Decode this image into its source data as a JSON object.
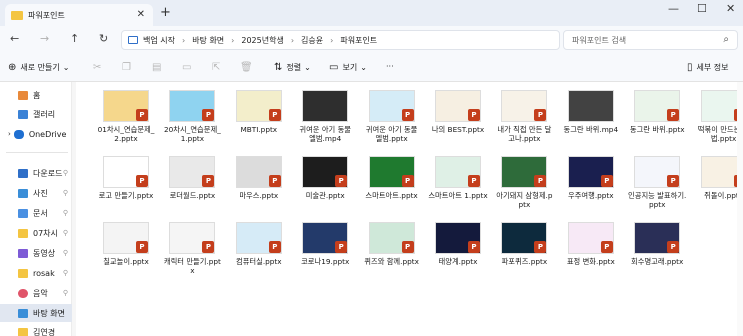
{
  "window": {
    "tab_title": "파워포인트",
    "new_tab": "+",
    "minimize": "—",
    "maximize": "☐",
    "close": "✕"
  },
  "nav": {
    "back": "←",
    "forward": "→",
    "up": "↑",
    "refresh": "↻",
    "breadcrumb": [
      "백업 시작",
      "바탕 화면",
      "2025년학생",
      "김승윤",
      "파워포인트"
    ],
    "search_placeholder": "파워포인트 검색"
  },
  "toolbar": {
    "new_label": "새로 만들기",
    "sort_label": "정렬",
    "view_label": "보기",
    "more_label": "···",
    "details_label": "세부 정보"
  },
  "sidebar": {
    "items": [
      {
        "label": "홈",
        "color": "#e8893a"
      },
      {
        "label": "갤러리",
        "color": "#3b82d6"
      },
      {
        "label": "OneDrive",
        "color": "#1f6fd1"
      },
      {
        "label": "다운로드",
        "color": "#2f6fc8"
      },
      {
        "label": "사진",
        "color": "#3a8ed8"
      },
      {
        "label": "문서",
        "color": "#4a90e2"
      },
      {
        "label": "07차시",
        "color": "#f4c542"
      },
      {
        "label": "동영상",
        "color": "#7d5bd6"
      },
      {
        "label": "rosak",
        "color": "#f4c542"
      },
      {
        "label": "음악",
        "color": "#e0556a"
      },
      {
        "label": "바탕 화면",
        "color": "#3a8ed8"
      },
      {
        "label": "김연경",
        "color": "#f4c542"
      }
    ]
  },
  "files": [
    {
      "name": "01차시_연습문제_2.pptx",
      "color": "#f5d78c",
      "ppt": true
    },
    {
      "name": "20차시_연습문제_1.pptx",
      "color": "#8fd3f0",
      "ppt": true
    },
    {
      "name": "MBTI.pptx",
      "color": "#f3eecb",
      "ppt": true
    },
    {
      "name": "귀여운 아기 동물 엘범.mp4",
      "color": "#2e2e2e",
      "ppt": false
    },
    {
      "name": "귀여운 아기 동물 엘범.pptx",
      "color": "#d5ecf7",
      "ppt": true
    },
    {
      "name": "나의 BEST.pptx",
      "color": "#f6efe2",
      "ppt": true
    },
    {
      "name": "내가 직접 만든 달고나.pptx",
      "color": "#f7f2e8",
      "ppt": true
    },
    {
      "name": "동그란 바위.mp4",
      "color": "#424242",
      "ppt": false
    },
    {
      "name": "동그란 바위.pptx",
      "color": "#eaf4ea",
      "ppt": true
    },
    {
      "name": "떡볶이 만드는 방법.pptx",
      "color": "#eaf6ef",
      "ppt": true
    },
    {
      "name": "로고 만들기.pptx",
      "color": "#ffffff",
      "ppt": true
    },
    {
      "name": "로더월드.pptx",
      "color": "#e9e9e9",
      "ppt": true
    },
    {
      "name": "마우스.pptx",
      "color": "#dcdcdc",
      "ppt": true
    },
    {
      "name": "미술관.pptx",
      "color": "#1d1d1d",
      "ppt": true
    },
    {
      "name": "스마트아트.pptx",
      "color": "#1f7a2f",
      "ppt": true
    },
    {
      "name": "스마트아트 1.pptx",
      "color": "#dff0e6",
      "ppt": true
    },
    {
      "name": "아기돼지 삼형제.pptx",
      "color": "#2e6b3a",
      "ppt": true
    },
    {
      "name": "우주여행.pptx",
      "color": "#1a1f4f",
      "ppt": true
    },
    {
      "name": "인공지능 발표하기.pptx",
      "color": "#f4f6fb",
      "ppt": true
    },
    {
      "name": "쥐돌이.pptx",
      "color": "#f8f1e4",
      "ppt": true
    },
    {
      "name": "칠교놀이.pptx",
      "color": "#f4f4f4",
      "ppt": true
    },
    {
      "name": "캐릭터 만들기.pptx",
      "color": "#f5f5f5",
      "ppt": true
    },
    {
      "name": "컴퓨터실.pptx",
      "color": "#d6ebf7",
      "ppt": true
    },
    {
      "name": "코로나19.pptx",
      "color": "#233a6a",
      "ppt": true
    },
    {
      "name": "퀴즈와 함께.pptx",
      "color": "#cfe8d9",
      "ppt": true
    },
    {
      "name": "태양계.pptx",
      "color": "#141a3c",
      "ppt": true
    },
    {
      "name": "파포퀴즈.pptx",
      "color": "#0d2a3d",
      "ppt": true
    },
    {
      "name": "표정 변화.pptx",
      "color": "#f7e9f6",
      "ppt": true
    },
    {
      "name": "회수명고래.pptx",
      "color": "#2a2f57",
      "ppt": true
    }
  ]
}
